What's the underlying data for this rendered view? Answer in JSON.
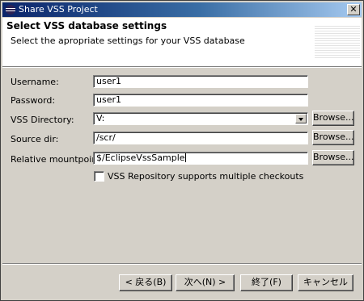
{
  "window": {
    "title": "Share VSS Project",
    "close_glyph": "✕"
  },
  "header": {
    "title": "Select VSS database settings",
    "description": "Select the apropriate settings for your VSS database"
  },
  "form": {
    "username": {
      "label": "Username:",
      "value": "user1"
    },
    "password": {
      "label": "Password:",
      "value": "user1"
    },
    "vss_directory": {
      "label": "VSS Directory:",
      "value": "V:"
    },
    "source_dir": {
      "label": "Source dir:",
      "value": "/scr/"
    },
    "relative_mountpoint": {
      "label": "Relative mountpoint:",
      "value": "$/EclipseVssSample"
    },
    "browse_label": "Browse...",
    "multiple_checkouts": {
      "label": "VSS Repository supports multiple checkouts",
      "checked": false
    }
  },
  "footer": {
    "back": "< 戻る(B)",
    "next": "次へ(N) >",
    "finish": "終了(F)",
    "cancel": "キャンセル"
  }
}
